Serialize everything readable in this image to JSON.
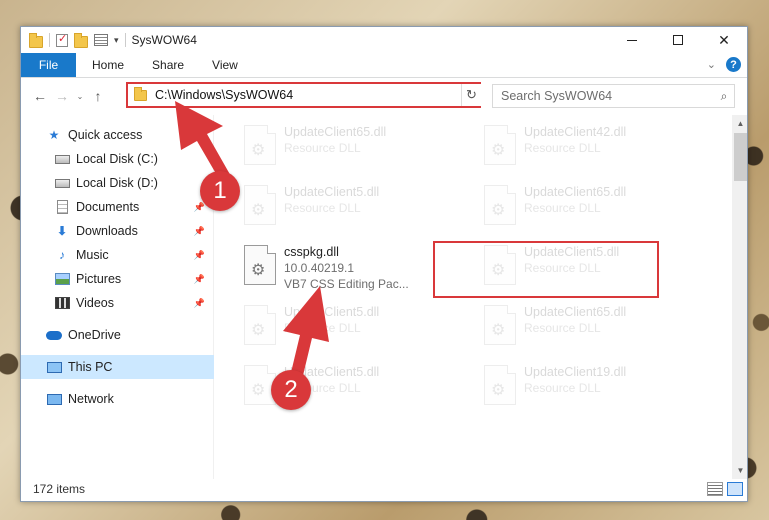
{
  "window": {
    "title": "SysWOW64",
    "qat_dropdown": "▾",
    "minimize": "",
    "maximize": "",
    "close": "✕"
  },
  "ribbon": {
    "tabs": [
      "File",
      "Home",
      "Share",
      "View"
    ],
    "collapse": "⌄",
    "help": "?"
  },
  "address": {
    "path": "C:\\Windows\\SysWOW64",
    "back": "←",
    "forward": "→",
    "recent": "⌄",
    "up": "↑",
    "dropdown": "⌄",
    "refresh": "↻"
  },
  "search": {
    "placeholder": "Search SysWOW64",
    "icon": "⌕"
  },
  "nav": {
    "items": [
      {
        "label": "Quick access",
        "icon": "star-icon",
        "pinned": false
      },
      {
        "label": "Local Disk (C:)",
        "icon": "disk-icon",
        "pinned": false
      },
      {
        "label": "Local Disk (D:)",
        "icon": "disk-icon",
        "pinned": false
      },
      {
        "label": "Documents",
        "icon": "document-icon",
        "pinned": true
      },
      {
        "label": "Downloads",
        "icon": "download-icon",
        "pinned": true
      },
      {
        "label": "Music",
        "icon": "music-icon",
        "pinned": true
      },
      {
        "label": "Pictures",
        "icon": "pictures-icon",
        "pinned": true
      },
      {
        "label": "Videos",
        "icon": "videos-icon",
        "pinned": true
      },
      {
        "label": "OneDrive",
        "icon": "onedrive-icon",
        "pinned": false
      },
      {
        "label": "This PC",
        "icon": "this-pc-icon",
        "pinned": false,
        "selected": true
      },
      {
        "label": "Network",
        "icon": "network-icon",
        "pinned": false
      }
    ],
    "pin_glyph": "📌"
  },
  "files": {
    "faded": [
      {
        "name": "UpdateClient65.dll",
        "type": "Resource DLL"
      },
      {
        "name": "UpdateClient42.dll",
        "type": "Resource DLL"
      },
      {
        "name": "UpdateClient5.dll",
        "type": "Resource DLL"
      },
      {
        "name": "UpdateClient65.dll",
        "type": "Resource DLL"
      },
      {
        "name": "UpdateClient5.dll",
        "type": "Resource DLL"
      },
      {
        "name": "UpdateClient5.dll",
        "type": "Resource DLL"
      },
      {
        "name": "UpdateClient65.dll",
        "type": "Resource DLL"
      },
      {
        "name": "UpdateClient5.dll",
        "type": "Resource DLL"
      },
      {
        "name": "UpdateClient19.dll",
        "type": "Resource DLL"
      }
    ],
    "highlighted": {
      "name": "csspkg.dll",
      "version": "10.0.40219.1",
      "description": "VB7 CSS Editing Pac..."
    }
  },
  "status": {
    "item_count": "172 items"
  },
  "annotations": {
    "step1": "1",
    "step2": "2",
    "accent": "#d9383a"
  },
  "colors": {
    "file_tab": "#1979ca",
    "selection": "#cce8ff"
  }
}
